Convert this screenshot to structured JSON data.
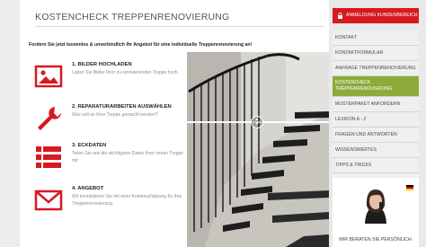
{
  "page": {
    "title": "KOSTENCHECK TREPPENRENOVIERUNG",
    "intro": "Fordern Sie jetzt kostenlos & unverbindlich Ihr Angebot für eine individuelle Treppenrenovierung an!"
  },
  "steps": [
    {
      "title": "1. BILDER HOCHLADEN",
      "desc": "Laden Sie Bilder Ihrer zu renovierenden Treppe hoch.",
      "icon": "image-icon"
    },
    {
      "title": "2. REPARATURARBEITEN AUSWÄHLEN",
      "desc": "Was soll an Ihrer Treppe gemacht werden?",
      "icon": "wrench-icon"
    },
    {
      "title": "3. ECKDATEN",
      "desc": "Teilen Sie uns die wichtigsten Daten Ihrer neuen Treppe mit",
      "icon": "list-icon"
    },
    {
      "title": "4. ANGEBOT",
      "desc": "Wir kontaktieren Sie mit einer Kostenschätzung für Ihre Treppenrenovierung.",
      "icon": "envelope-icon"
    }
  ],
  "sidebar": {
    "cta_label": "ANMELDUNG KUNDENBEREICH",
    "menu": [
      {
        "label": "KONTAKT"
      },
      {
        "label": "KONTAKTFORMULAR"
      },
      {
        "label": "ANFRAGE TREPPENRENOVIERUNG"
      },
      {
        "label": "KOSTENCHECK TREPPENRENOVIERUNG",
        "active": true
      },
      {
        "label": "MUSTERPAKET ANFORDERN"
      },
      {
        "label": "LEXIKON A - Z"
      },
      {
        "label": "FRAGEN UND ANTWORTEN"
      },
      {
        "label": "WISSENSWERTES"
      },
      {
        "label": "TIPPS & TRICKS"
      },
      {
        "label": "ANMELDUNG KUNDENBEREICH"
      }
    ],
    "advisor_text": "WIR BERATEN SIE PERSÖNLICH:"
  },
  "colors": {
    "accent_red": "#d71920",
    "active_green": "#8cab3a"
  }
}
